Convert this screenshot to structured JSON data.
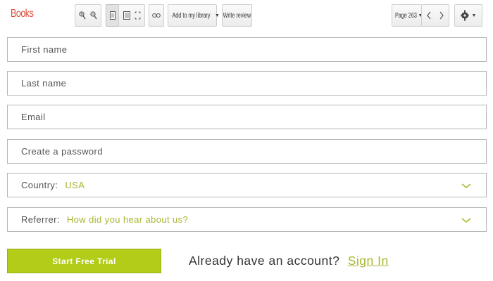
{
  "toolbar": {
    "brand": "Books",
    "add_to_library_label": "Add to my library",
    "write_review_label": "Write review",
    "page_label": "Page 263"
  },
  "form": {
    "first_name_placeholder": "First name",
    "last_name_placeholder": "Last name",
    "email_placeholder": "Email",
    "password_placeholder": "Create a password",
    "country_label": "Country:",
    "country_value": "USA",
    "referrer_label": "Referrer:",
    "referrer_value": "How did you hear about us?",
    "submit_label": "Start Free Trial",
    "signin_prompt": "Already have an account?",
    "signin_link": "Sign In"
  },
  "colors": {
    "brand": "#dd4b39",
    "accent_green": "#b2cc18",
    "value_text": "#a9b52c"
  },
  "icons": [
    "zoom-in-icon",
    "zoom-out-icon",
    "single-page-icon",
    "two-page-icon",
    "fullscreen-icon",
    "link-icon",
    "dropdown-caret-icon",
    "prev-page-icon",
    "next-page-icon",
    "gear-icon",
    "chevron-down-icon"
  ]
}
